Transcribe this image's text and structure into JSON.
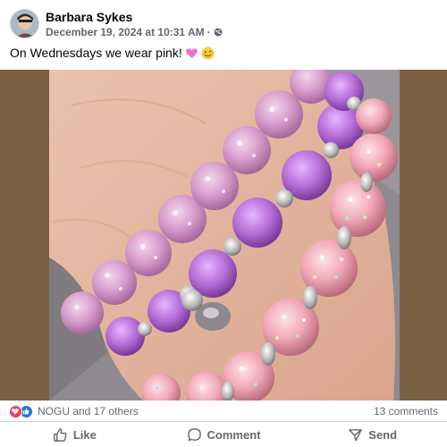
{
  "post": {
    "author": "Barbara Sykes",
    "date": "December 19, 2024 at 10:31 AM",
    "separator": "·",
    "caption": "On Wednesdays we wear pink!",
    "caption_emojis": [
      "pink-heart-emoji",
      "winking-face-emoji"
    ]
  },
  "reactions": {
    "icons": [
      "love-reaction-icon",
      "like-reaction-icon"
    ],
    "summary": "NOGU and 17 others",
    "comments": "13 comments"
  },
  "actions": {
    "like": "Like",
    "comment": "Comment",
    "send": "Send"
  },
  "colors": {
    "text_primary": "#050505",
    "text_secondary": "#65676b",
    "love": "#f33e58",
    "like": "#1877f2",
    "photo_frame": "#7a6144"
  }
}
